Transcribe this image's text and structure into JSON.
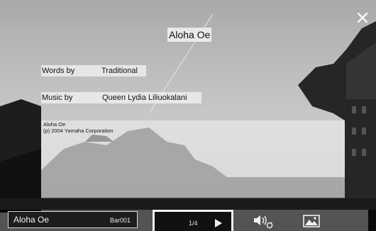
{
  "lyrics_view": {
    "title": "Aloha Oe",
    "words_label": "Words by",
    "words_value": "Traditional",
    "music_label": "Music by",
    "music_value": "Queen Lydia Liliuokalani",
    "body_lines": [
      "Aloha Oe",
      "(p) 2004 Yamaha Corporation"
    ]
  },
  "bottom_bar": {
    "song_name": "Aloha Oe",
    "bar": "Bar001",
    "page": "1/4"
  },
  "icons": {
    "close": "close-icon",
    "play": "play-icon",
    "audio": "speaker-loop-icon",
    "background": "image-icon"
  }
}
